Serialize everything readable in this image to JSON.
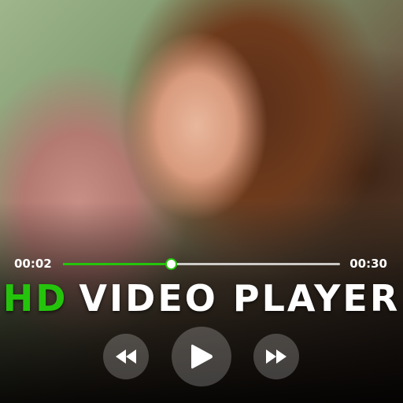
{
  "player": {
    "current_time": "00:02",
    "total_time": "00:30",
    "progress": 0.39,
    "title_prefix": "HD",
    "title_main": "VIDEO PLAYER",
    "accent_color": "#25c40c"
  },
  "controls": {
    "prev_icon": "rewind-icon",
    "play_icon": "play-icon",
    "next_icon": "fast-forward-icon"
  }
}
